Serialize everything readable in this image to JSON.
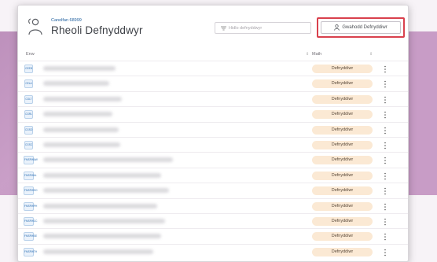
{
  "header": {
    "centre_name": "Canolfan 68999",
    "page_title": "Rheoli Defnyddwyr"
  },
  "search": {
    "placeholder": "Hidlo defnyddwyr"
  },
  "invite_button": {
    "label": "Gwahodd Defnyddiwr"
  },
  "table": {
    "columns": {
      "name": "Enw",
      "type": "Math"
    },
    "rows": [
      {
        "code": "CEEB",
        "type": "Defnyddiwr"
      },
      {
        "code": "CELA",
        "type": "Defnyddiwr"
      },
      {
        "code": "CGLT",
        "type": "Defnyddiwr"
      },
      {
        "code": "CGRL",
        "type": "Defnyddiwr"
      },
      {
        "code": "CGSO",
        "type": "Defnyddiwr"
      },
      {
        "code": "CGSC",
        "type": "Defnyddiwr"
      },
      {
        "code": "FMSPWAW",
        "type": "Defnyddiwr"
      },
      {
        "code": "FMSPWAL",
        "type": "Defnyddiwr"
      },
      {
        "code": "FMSPWSO",
        "type": "Defnyddiwr"
      },
      {
        "code": "FMSPWPH",
        "type": "Defnyddiwr"
      },
      {
        "code": "FMSPWCC",
        "type": "Defnyddiwr"
      },
      {
        "code": "FMSPWSE",
        "type": "Defnyddiwr"
      },
      {
        "code": "FMSPWTH",
        "type": "Defnyddiwr"
      }
    ]
  },
  "colors": {
    "accent": "#1f5f9e",
    "highlight": "#d9414d",
    "badge_bg": "#fbe9d4",
    "backdrop_band": "#c89cc6"
  }
}
